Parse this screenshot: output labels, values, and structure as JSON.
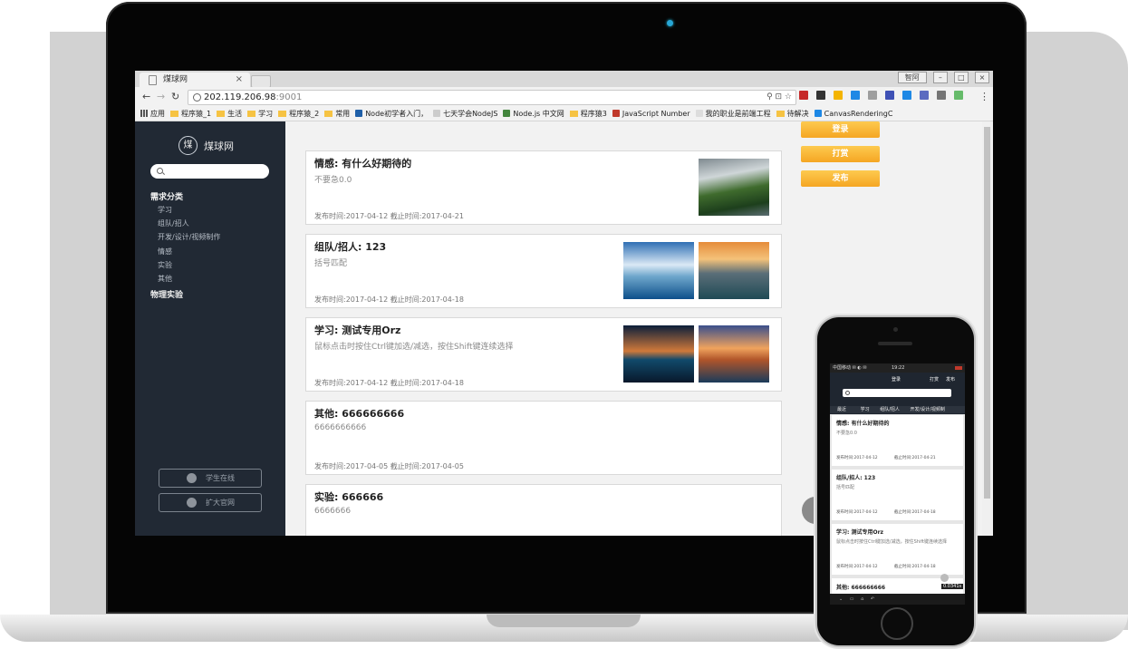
{
  "browser": {
    "tab_title": "煤球网",
    "tab_close": "×",
    "url_host": "202.119.206.98",
    "url_port": ":9001",
    "window_user": "智阿",
    "window_btns": [
      "–",
      "□",
      "×"
    ],
    "omnibox_icons": "⚲ ⊡ ☆",
    "bookmarks": [
      {
        "label": "应用",
        "icon": "apps"
      },
      {
        "label": "程序猿_1",
        "icon": "folder"
      },
      {
        "label": "生活",
        "icon": "folder"
      },
      {
        "label": "学习",
        "icon": "folder"
      },
      {
        "label": "程序猿_2",
        "icon": "folder"
      },
      {
        "label": "常用",
        "icon": "folder"
      },
      {
        "label": "Node初学者入门，",
        "icon": "favicon",
        "color": "#1f5fa8"
      },
      {
        "label": "七天学会NodeJS",
        "icon": "favicon",
        "color": "#cccccc"
      },
      {
        "label": "Node.js 中文网",
        "icon": "favicon",
        "color": "#43853d"
      },
      {
        "label": "程序猿3",
        "icon": "folder"
      },
      {
        "label": "JavaScript Number",
        "icon": "favicon",
        "color": "#c0392b"
      },
      {
        "label": "我的职业是前端工程",
        "icon": "favicon",
        "color": "#dddddd"
      },
      {
        "label": "待解决",
        "icon": "folder"
      },
      {
        "label": "CanvasRenderingC",
        "icon": "favicon",
        "color": "#1e88e5"
      }
    ],
    "ext_colors": [
      "#c62828",
      "#333333",
      "#f4b400",
      "#1e88e5",
      "#9e9e9e",
      "#3f51b5",
      "#1e88e5",
      "#5c6bc0",
      "#757575",
      "#66bb6a"
    ]
  },
  "sidebar": {
    "logo_mark": "煤",
    "site_name": "煤球网",
    "section_demand": "需求分类",
    "items": [
      "学习",
      "组队/招人",
      "开发/设计/视频制作",
      "情感",
      "实验",
      "其他"
    ],
    "section_physics": "物理实验",
    "btn_student": "学生在线",
    "btn_official": "扩大官网"
  },
  "actions": {
    "login": "登录",
    "reward": "打赏",
    "publish": "发布"
  },
  "posts": [
    {
      "title": "情感: 有什么好期待的",
      "subtitle": "不要急0.0",
      "time": "发布时间:2017-04-12 截止时间:2017-04-21"
    },
    {
      "title": "组队/招人: 123",
      "subtitle": "括号匹配",
      "time": "发布时间:2017-04-12 截止时间:2017-04-18"
    },
    {
      "title": "学习: 测试专用Orz",
      "subtitle": "鼠标点击时按住Ctrl键加选/减选，按住Shift键连续选择",
      "time": "发布时间:2017-04-12 截止时间:2017-04-18"
    },
    {
      "title": "其他: 666666666",
      "subtitle": "6666666666",
      "time": "发布时间:2017-04-05 截止时间:2017-04-05"
    },
    {
      "title": "实验: 666666",
      "subtitle": "6666666"
    }
  ],
  "phone": {
    "status_carrier": "中国移动 ✉ ◐ ✉",
    "status_time": "19:22",
    "header_login": "登录",
    "header_reward": "打赏",
    "header_publish": "发布",
    "nav": [
      "最近",
      "学习",
      "组队/招人",
      "开发/设计/视频制"
    ],
    "cards": [
      {
        "title": "情感: 有什么好期待的",
        "subtitle": "不要急0.0",
        "publish": "发布时间:2017-04-12",
        "end": "截止时间:2017-04-21"
      },
      {
        "title": "组队/招人: 123",
        "subtitle": "括号匹配",
        "publish": "发布时间:2017-04-12",
        "end": "截止时间:2017-04-18"
      },
      {
        "title": "学习: 测试专用Orz",
        "subtitle": "鼠标点击时按住Ctrl键加选/减选，按住Shift键连续选择",
        "publish": "发布时间:2017-04-12",
        "end": "截止时间:2017-04-18"
      },
      {
        "title": "其他: 666666666"
      }
    ],
    "speed": "0.0341s",
    "bottom_icons": "⌄  ▭  ⌂  ↶"
  }
}
